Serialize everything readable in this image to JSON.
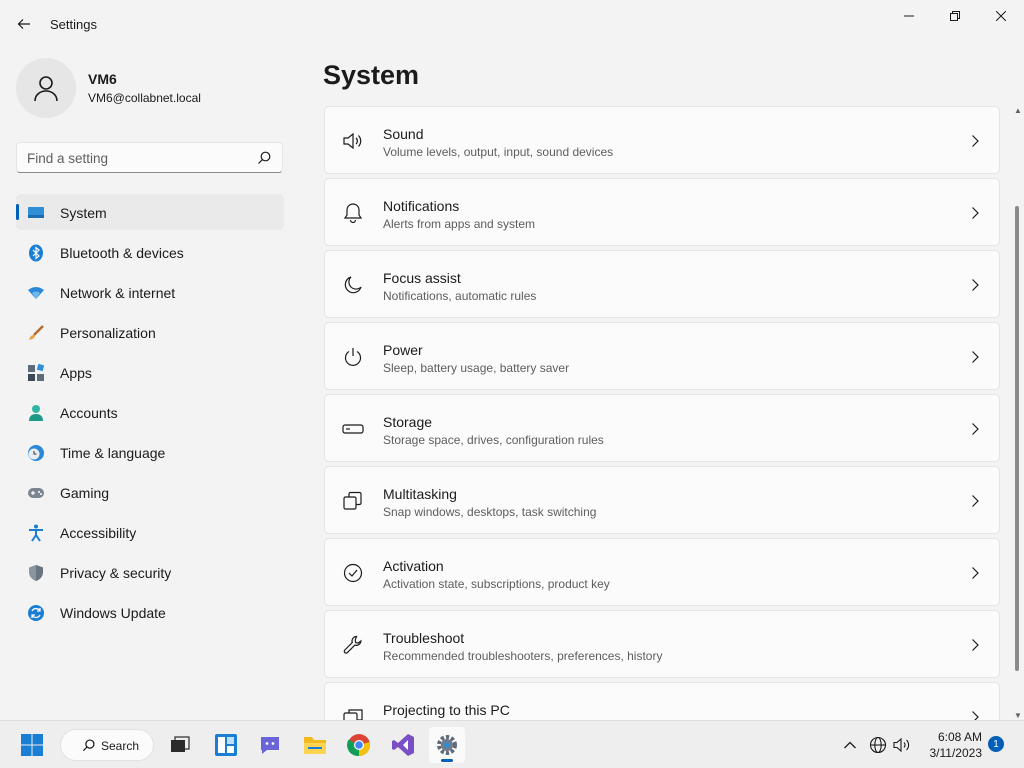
{
  "window": {
    "title": "Settings"
  },
  "profile": {
    "name": "VM6",
    "email": "VM6@collabnet.local"
  },
  "search": {
    "placeholder": "Find a setting"
  },
  "page": {
    "title": "System"
  },
  "sidebar": {
    "items": [
      {
        "label": "System",
        "icon": "system-icon",
        "active": true
      },
      {
        "label": "Bluetooth & devices",
        "icon": "bluetooth-icon"
      },
      {
        "label": "Network & internet",
        "icon": "network-icon"
      },
      {
        "label": "Personalization",
        "icon": "personalization-icon"
      },
      {
        "label": "Apps",
        "icon": "apps-icon"
      },
      {
        "label": "Accounts",
        "icon": "accounts-icon"
      },
      {
        "label": "Time & language",
        "icon": "time-language-icon"
      },
      {
        "label": "Gaming",
        "icon": "gaming-icon"
      },
      {
        "label": "Accessibility",
        "icon": "accessibility-icon"
      },
      {
        "label": "Privacy & security",
        "icon": "privacy-icon"
      },
      {
        "label": "Windows Update",
        "icon": "windows-update-icon"
      }
    ]
  },
  "settings": {
    "items": [
      {
        "title": "Sound",
        "description": "Volume levels, output, input, sound devices",
        "icon": "speaker-icon"
      },
      {
        "title": "Notifications",
        "description": "Alerts from apps and system",
        "icon": "bell-icon"
      },
      {
        "title": "Focus assist",
        "description": "Notifications, automatic rules",
        "icon": "moon-icon"
      },
      {
        "title": "Power",
        "description": "Sleep, battery usage, battery saver",
        "icon": "power-icon"
      },
      {
        "title": "Storage",
        "description": "Storage space, drives, configuration rules",
        "icon": "storage-icon"
      },
      {
        "title": "Multitasking",
        "description": "Snap windows, desktops, task switching",
        "icon": "multitasking-icon"
      },
      {
        "title": "Activation",
        "description": "Activation state, subscriptions, product key",
        "icon": "activation-icon"
      },
      {
        "title": "Troubleshoot",
        "description": "Recommended troubleshooters, preferences, history",
        "icon": "wrench-icon"
      },
      {
        "title": "Projecting to this PC",
        "description": "",
        "icon": "projecting-icon"
      }
    ]
  },
  "taskbar": {
    "search_label": "Search",
    "time": "6:08 AM",
    "date": "3/11/2023",
    "notification_count": "1"
  },
  "colors": {
    "accent": "#005fb8",
    "background": "#f3f3f3",
    "card": "#fbfbfb"
  }
}
